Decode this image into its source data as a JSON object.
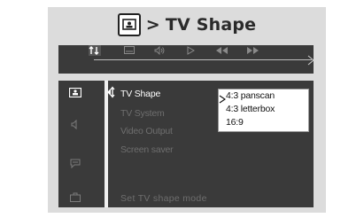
{
  "heading": {
    "separator": ">",
    "title": "TV Shape",
    "icon": "tv-screen-icon"
  },
  "topbar": {
    "icons": [
      "preference-icon",
      "subtitle-icon",
      "audio-icon",
      "play-icon",
      "rewind-icon",
      "fast-forward-icon"
    ],
    "arrow_icon": "arrow-right-icon"
  },
  "sidebar": {
    "icons": [
      "video-setup-icon",
      "audio-setup-icon",
      "subtitle-setup-icon",
      "preference-setup-icon"
    ]
  },
  "menu": {
    "items": [
      "TV Shape",
      "TV System",
      "Video Output",
      "Screen saver"
    ],
    "active_index": 0
  },
  "submenu": {
    "options": [
      "4:3 panscan",
      "4:3 letterbox",
      "16:9"
    ],
    "selected_index": 0
  },
  "status": {
    "text": "Set TV shape mode"
  },
  "colors": {
    "panel": "#3a3a3a",
    "frame": "#dcdcdc",
    "active_text": "#ffffff",
    "inactive_text": "#6e6e6e"
  }
}
